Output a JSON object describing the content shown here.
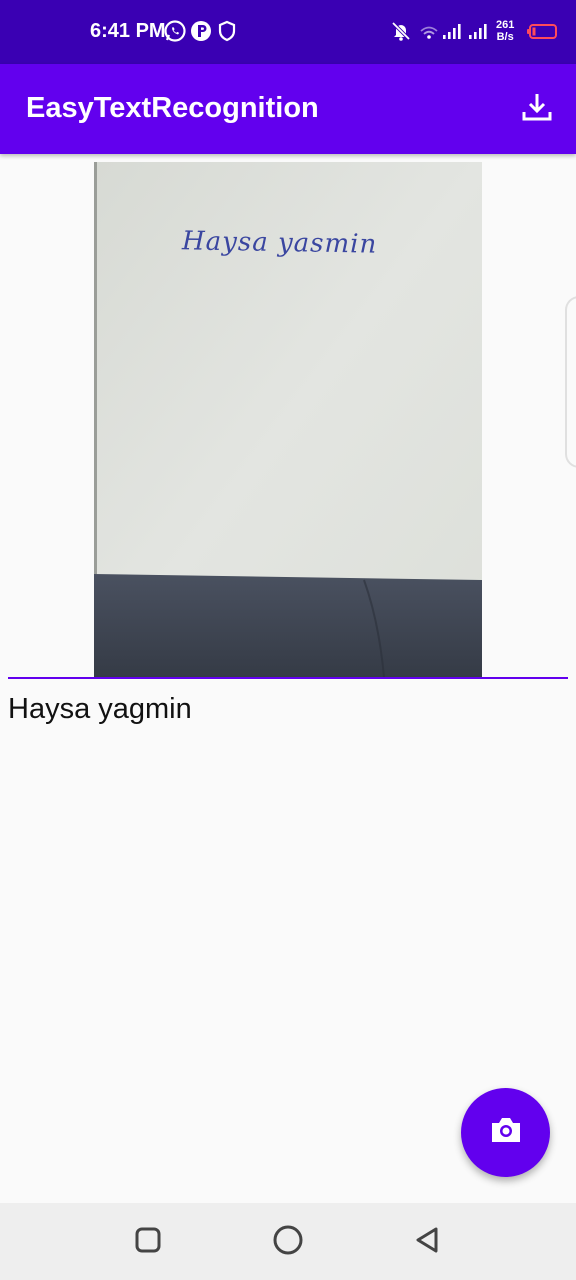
{
  "status_bar": {
    "time": "6:41 PM",
    "net_speed_value": "261",
    "net_speed_unit": "B/s",
    "icons": [
      "whatsapp-icon",
      "p-app-icon",
      "shield-icon",
      "mute-bell-icon",
      "wifi-icon",
      "signal-icon",
      "signal-icon",
      "battery-low-icon"
    ]
  },
  "app_bar": {
    "title": "EasyTextRecognition",
    "action_icon": "download-icon"
  },
  "preview": {
    "handwriting": "Haysa yasmin"
  },
  "result": {
    "text": "Haysa yagmin"
  },
  "fab": {
    "icon": "camera-icon"
  },
  "nav_bar": {
    "icons": [
      "recents-icon",
      "home-icon",
      "back-icon"
    ]
  },
  "colors": {
    "status_bar": "#3a00b3",
    "primary": "#6200ee",
    "background": "#fafafa"
  }
}
